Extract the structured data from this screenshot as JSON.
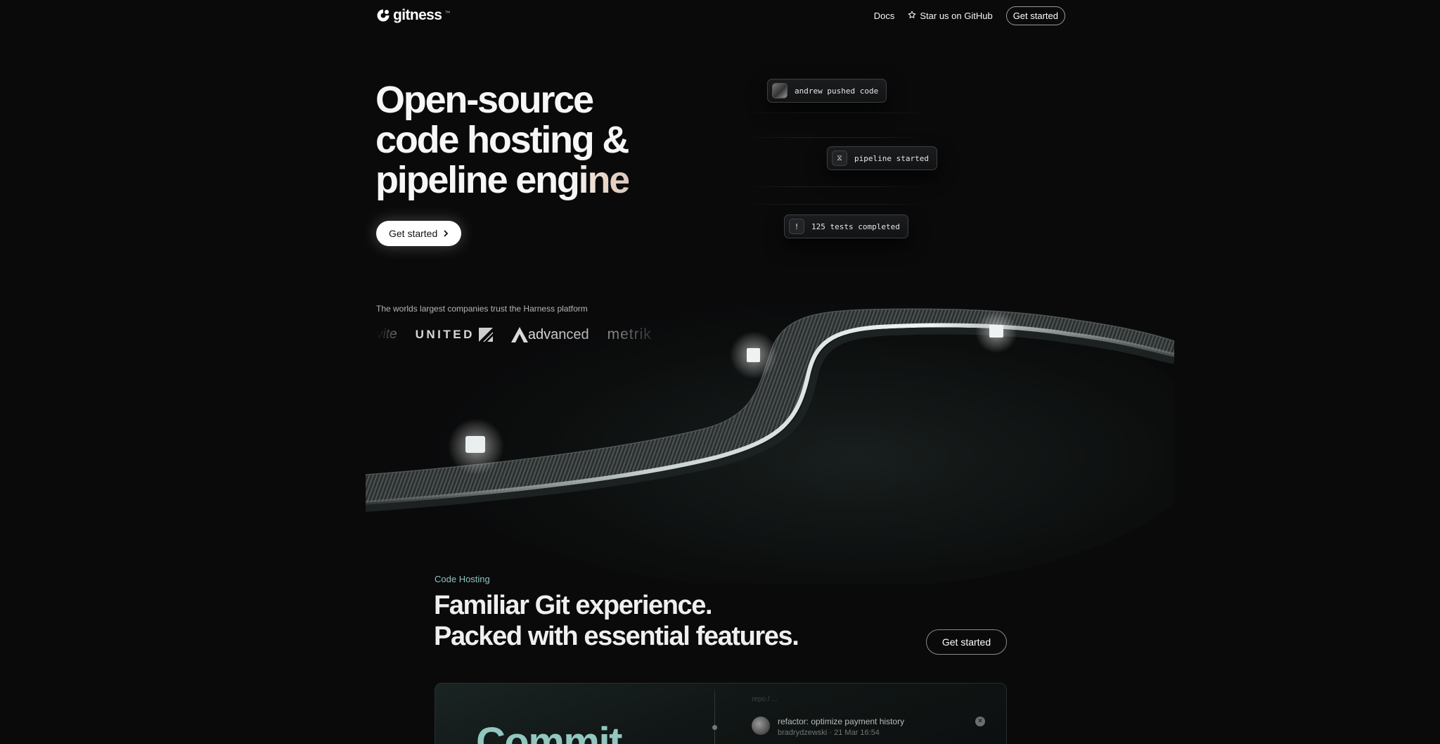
{
  "nav": {
    "brand": "gitness",
    "brand_tm": "™",
    "links": {
      "docs": "Docs",
      "github": "Star us on GitHub",
      "get_started": "Get started"
    }
  },
  "hero": {
    "title_line1": "Open-source",
    "title_line2": "code hosting &",
    "title_line3a": "pipeline e",
    "title_line3b": "ngine",
    "cta": "Get started",
    "cta_icon": "chevron-right-icon"
  },
  "events": [
    {
      "icon": "user-avatar",
      "text": "andrew pushed code"
    },
    {
      "icon": "hourglass-icon",
      "glyph": "⧖",
      "text": "pipeline started"
    },
    {
      "icon": "exclamation-icon",
      "glyph": "!",
      "text": "125 tests completed"
    }
  ],
  "trust": {
    "caption": "The worlds largest companies trust the Harness platform",
    "logos": [
      "vite",
      "UNITED",
      "advanced",
      "metrik"
    ]
  },
  "code_hosting": {
    "label": "Code Hosting",
    "title_line1": "Familiar Git experience.",
    "title_line2": "Packed with essential features.",
    "cta": "Get started",
    "panel": {
      "big_word": "Commit",
      "breadcrumb": "repo / ...",
      "commit_message": "refactor: optimize payment history",
      "commit_author": "bradrydzewski",
      "commit_time": "21 Mar 16:54",
      "separator": "·"
    }
  },
  "colors": {
    "background": "#0a0a0b",
    "accent_teal": "#8cc4bd",
    "text": "#f2f2f2"
  }
}
